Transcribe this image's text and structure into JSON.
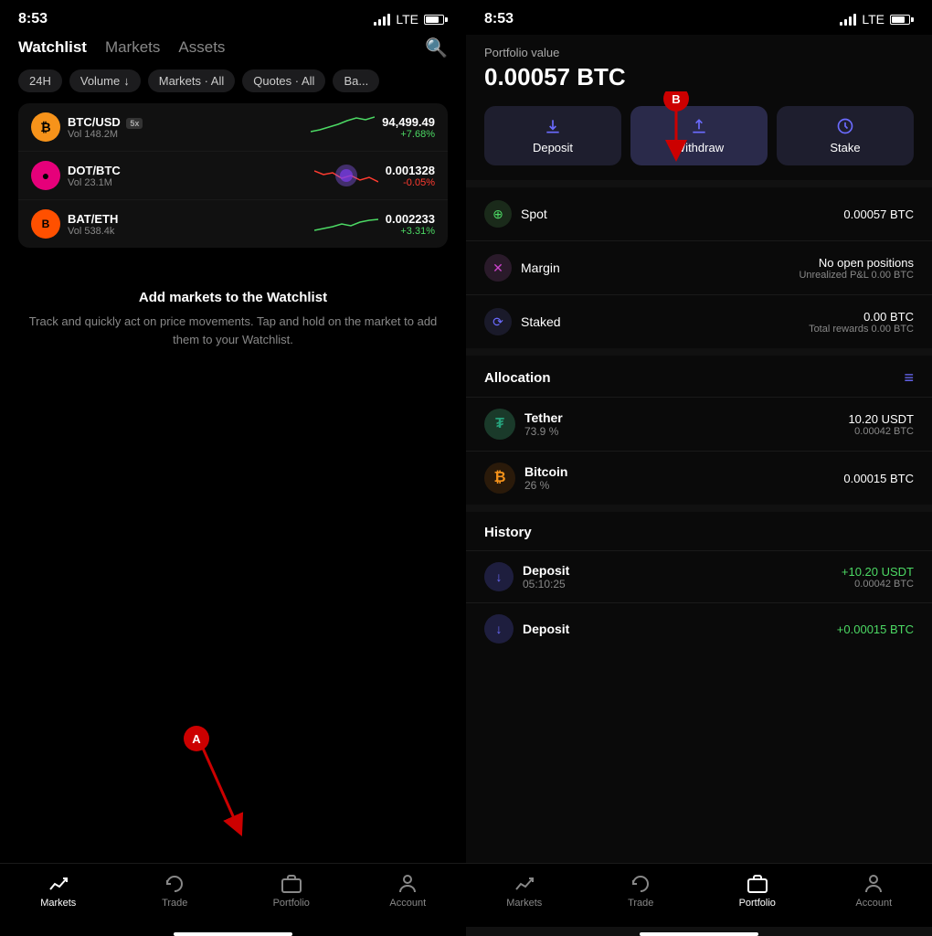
{
  "left": {
    "status": {
      "time": "8:53",
      "carrier": "LTE"
    },
    "nav_tabs": [
      {
        "id": "watchlist",
        "label": "Watchlist",
        "active": true
      },
      {
        "id": "markets",
        "label": "Markets",
        "active": false
      },
      {
        "id": "assets",
        "label": "Assets",
        "active": false
      }
    ],
    "filter_chips": [
      {
        "label": "24H",
        "icon": ""
      },
      {
        "label": "Volume",
        "icon": "↓"
      },
      {
        "label": "Markets · All",
        "icon": ""
      },
      {
        "label": "Quotes · All",
        "icon": ""
      },
      {
        "label": "Ba...",
        "icon": ""
      }
    ],
    "watchlist_rows": [
      {
        "pair": "BTC/USD",
        "badge": "5x",
        "vol": "Vol 148.2M",
        "price": "94,499.49",
        "change": "+7.68%",
        "change_positive": true,
        "coin_color": "#f7931a",
        "coin_letter": "₿"
      },
      {
        "pair": "DOT/BTC",
        "badge": "",
        "vol": "Vol 23.1M",
        "price": "0.001328",
        "change": "-0.05%",
        "change_positive": false,
        "coin_color": "#e6007a",
        "coin_letter": "●"
      },
      {
        "pair": "BAT/ETH",
        "badge": "",
        "vol": "Vol 538.4k",
        "price": "0.002233",
        "change": "+3.31%",
        "change_positive": true,
        "coin_color": "#ff5000",
        "coin_letter": "B"
      }
    ],
    "watchlist_empty_title": "Add markets to the Watchlist",
    "watchlist_empty_body": "Track and quickly act on price movements. Tap and hold on the market to add them to your Watchlist.",
    "annotation_a": "A",
    "bottom_nav": [
      {
        "id": "markets",
        "label": "Markets",
        "active": true,
        "icon": "markets"
      },
      {
        "id": "trade",
        "label": "Trade",
        "active": false,
        "icon": "trade"
      },
      {
        "id": "portfolio",
        "label": "Portfolio",
        "active": false,
        "icon": "portfolio"
      },
      {
        "id": "account",
        "label": "Account",
        "active": false,
        "icon": "account"
      }
    ]
  },
  "right": {
    "status": {
      "time": "8:53",
      "carrier": "LTE"
    },
    "portfolio": {
      "label": "Portfolio value",
      "value": "0.00057 BTC"
    },
    "action_buttons": [
      {
        "id": "deposit",
        "label": "Deposit",
        "icon": "download",
        "active": false
      },
      {
        "id": "withdraw",
        "label": "Withdraw",
        "icon": "upload",
        "active": true
      },
      {
        "id": "stake",
        "label": "Stake",
        "icon": "stake",
        "active": false
      }
    ],
    "annotation_b": "B",
    "balances": [
      {
        "id": "spot",
        "name": "Spot",
        "icon": "spot",
        "icon_bg": "#1a2a1a",
        "icon_color": "#4cd964",
        "value": "0.00057 BTC",
        "sub": ""
      },
      {
        "id": "margin",
        "name": "Margin",
        "icon": "margin",
        "icon_bg": "#2a1a2a",
        "icon_color": "#cc44cc",
        "value": "No open positions",
        "sub": "Unrealized P&L  0.00 BTC"
      },
      {
        "id": "staked",
        "name": "Staked",
        "icon": "staked",
        "icon_bg": "#1a1a2a",
        "icon_color": "#6b6bff",
        "value": "0.00 BTC",
        "sub": "Total rewards  0.00 BTC"
      }
    ],
    "allocation": {
      "title": "Allocation",
      "items": [
        {
          "id": "tether",
          "name": "Tether",
          "pct": "73.9 %",
          "primary": "10.20 USDT",
          "secondary": "0.00042 BTC",
          "icon_bg": "#1a3a2a",
          "icon_color": "#26a17b",
          "icon_letter": "₮"
        },
        {
          "id": "bitcoin",
          "name": "Bitcoin",
          "pct": "26 %",
          "primary": "0.00015 BTC",
          "secondary": "",
          "icon_bg": "#2a1a0a",
          "icon_color": "#f7931a",
          "icon_letter": "₿"
        }
      ]
    },
    "history": {
      "title": "History",
      "items": [
        {
          "id": "deposit1",
          "type": "Deposit",
          "time": "05:10:25",
          "amount": "+10.20  USDT",
          "btc": "0.00042 BTC"
        },
        {
          "id": "deposit2",
          "type": "Deposit",
          "time": "",
          "amount": "+0.00015 BTC",
          "btc": ""
        }
      ]
    },
    "bottom_nav": [
      {
        "id": "markets",
        "label": "Markets",
        "active": false,
        "icon": "markets"
      },
      {
        "id": "trade",
        "label": "Trade",
        "active": false,
        "icon": "trade"
      },
      {
        "id": "portfolio",
        "label": "Portfolio",
        "active": true,
        "icon": "portfolio"
      },
      {
        "id": "account",
        "label": "Account",
        "active": false,
        "icon": "account"
      }
    ]
  }
}
